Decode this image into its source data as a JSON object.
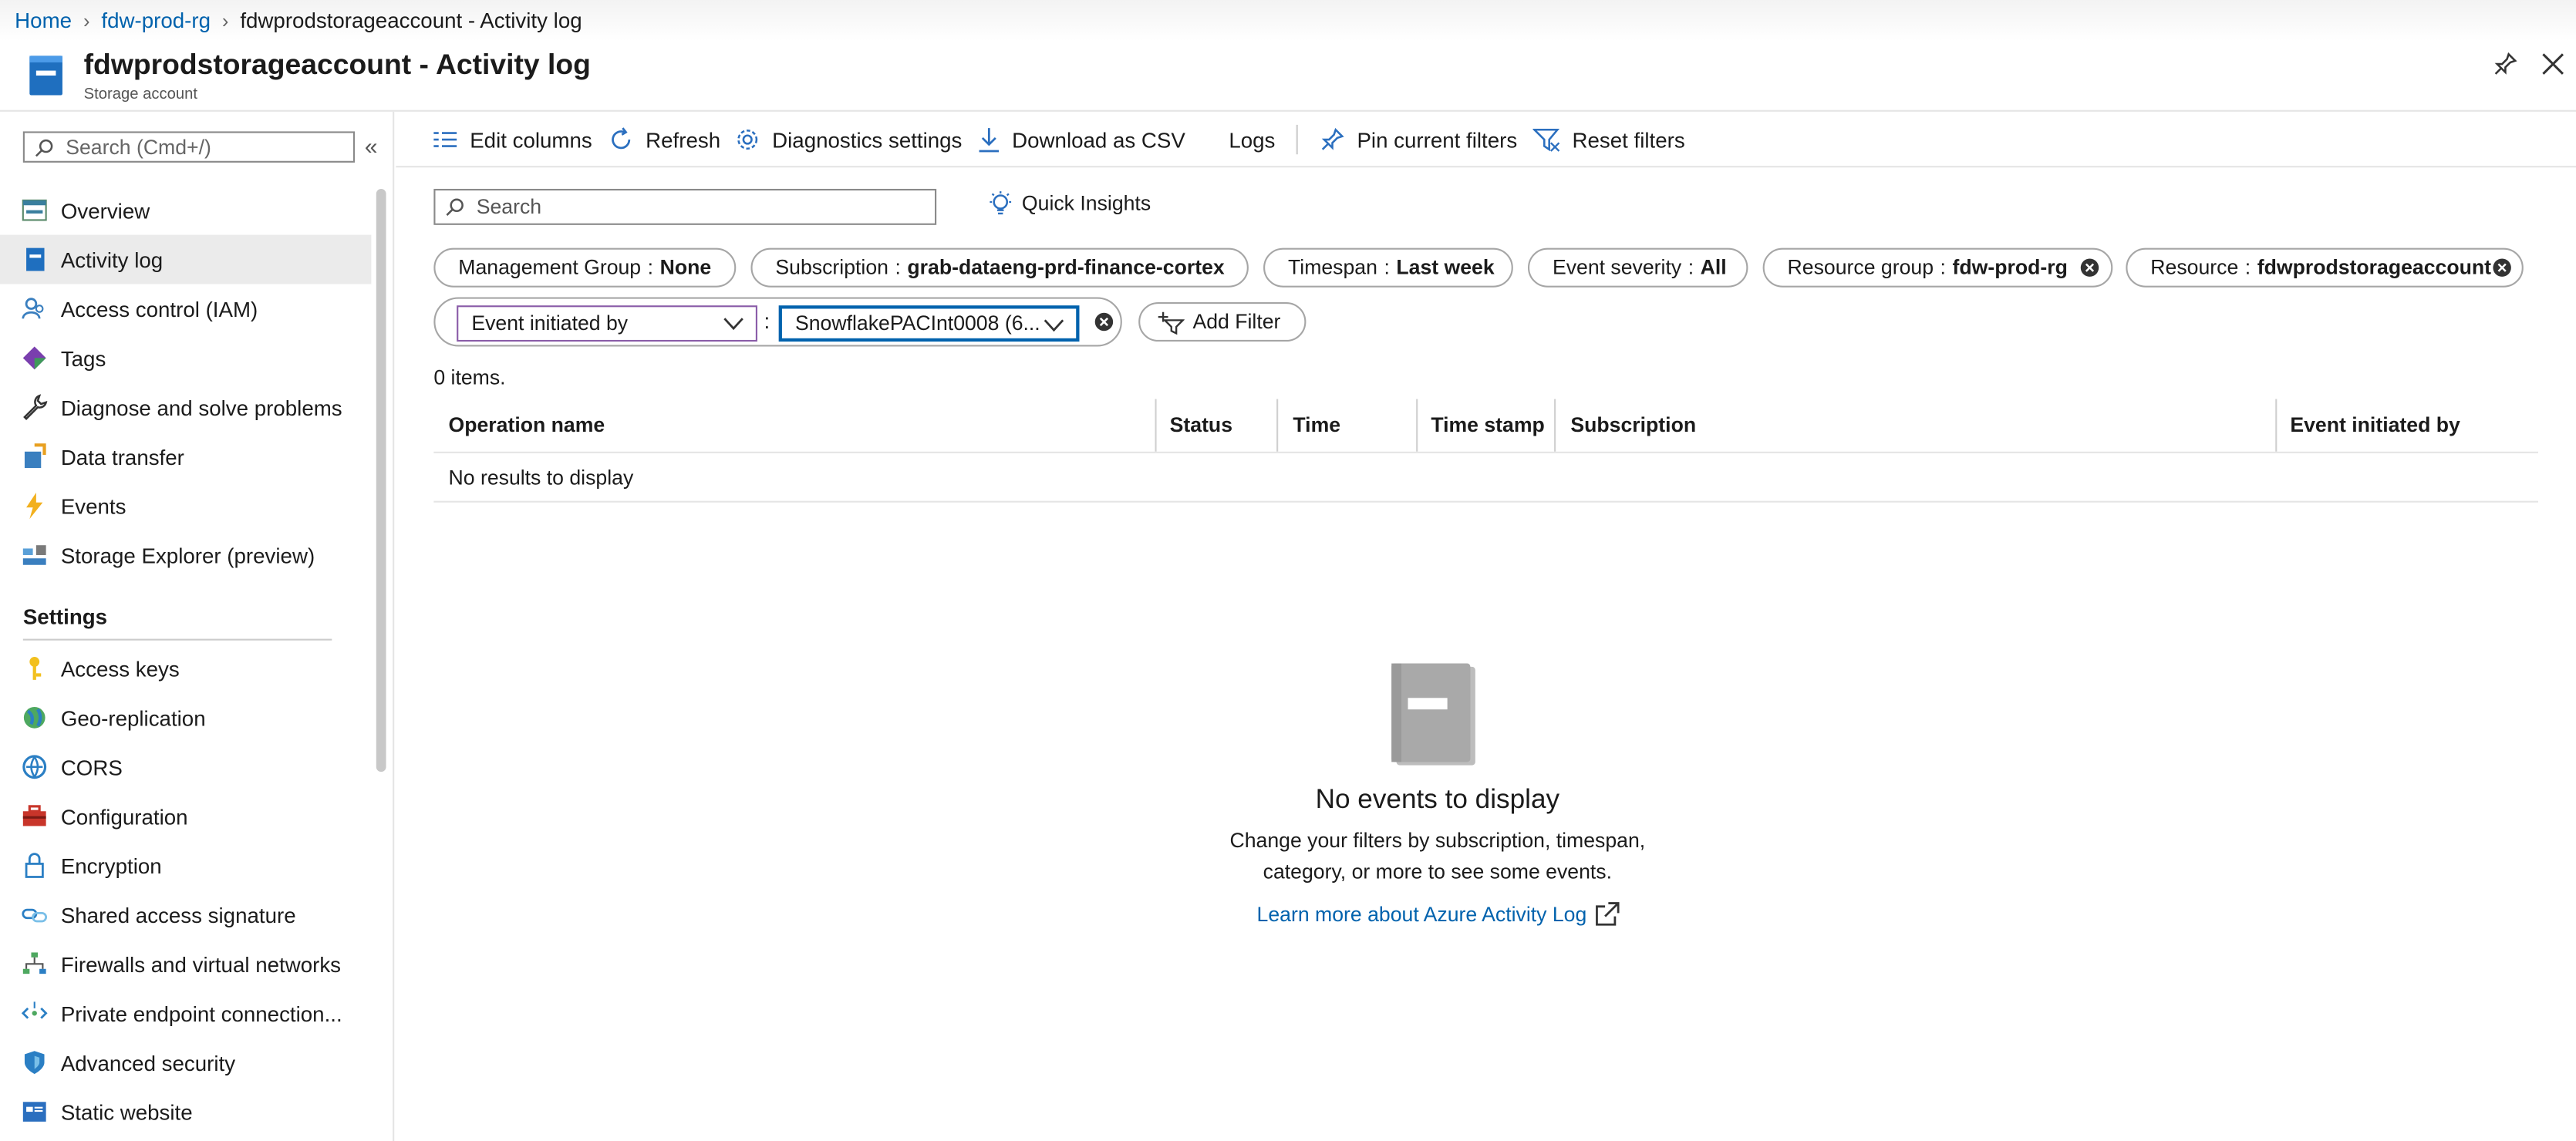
{
  "breadcrumb": {
    "home": "Home",
    "resource_group": "fdw-prod-rg",
    "current": "fdwprodstorageaccount - Activity log"
  },
  "header": {
    "title": "fdwprodstorageaccount - Activity log",
    "subtitle": "Storage account"
  },
  "sidebar": {
    "search_placeholder": "Search (Cmd+/)",
    "collapse_glyph": "«",
    "items": [
      {
        "label": "Overview",
        "icon": "overview-icon"
      },
      {
        "label": "Activity log",
        "icon": "activity-log-icon",
        "active": true
      },
      {
        "label": "Access control (IAM)",
        "icon": "iam-icon"
      },
      {
        "label": "Tags",
        "icon": "tag-icon"
      },
      {
        "label": "Diagnose and solve problems",
        "icon": "wrench-icon"
      },
      {
        "label": "Data transfer",
        "icon": "data-transfer-icon"
      },
      {
        "label": "Events",
        "icon": "lightning-icon"
      },
      {
        "label": "Storage Explorer (preview)",
        "icon": "storage-explorer-icon"
      }
    ],
    "settings_heading": "Settings",
    "settings_items": [
      {
        "label": "Access keys",
        "icon": "key-icon"
      },
      {
        "label": "Geo-replication",
        "icon": "globe-icon"
      },
      {
        "label": "CORS",
        "icon": "cors-icon"
      },
      {
        "label": "Configuration",
        "icon": "toolbox-icon"
      },
      {
        "label": "Encryption",
        "icon": "lock-icon"
      },
      {
        "label": "Shared access signature",
        "icon": "link-icon"
      },
      {
        "label": "Firewalls and virtual networks",
        "icon": "network-icon"
      },
      {
        "label": "Private endpoint connection...",
        "icon": "endpoint-icon"
      },
      {
        "label": "Advanced security",
        "icon": "shield-icon"
      },
      {
        "label": "Static website",
        "icon": "website-icon"
      }
    ]
  },
  "toolbar": {
    "edit_columns": "Edit columns",
    "refresh": "Refresh",
    "diagnostics_settings": "Diagnostics settings",
    "download_csv": "Download as CSV",
    "logs": "Logs",
    "pin_filters": "Pin current filters",
    "reset_filters": "Reset filters"
  },
  "search": {
    "placeholder": "Search",
    "quick_insights": "Quick Insights"
  },
  "filters": [
    {
      "key": "Management Group",
      "value": "None",
      "removable": false
    },
    {
      "key": "Subscription",
      "value": "grab-dataeng-prd-finance-cortex",
      "removable": false
    },
    {
      "key": "Timespan",
      "value": "Last week",
      "removable": false
    },
    {
      "key": "Event severity",
      "value": "All",
      "removable": false
    },
    {
      "key": "Resource group",
      "value": "fdw-prod-rg",
      "removable": true
    },
    {
      "key": "Resource",
      "value": "fdwprodstorageaccount",
      "removable": true
    }
  ],
  "filter_separator": ":",
  "custom_filter": {
    "field": "Event initiated by",
    "value": "SnowflakePACInt0008 (6..."
  },
  "add_filter": "Add Filter",
  "item_count": "0 items.",
  "table": {
    "columns": [
      "Operation name",
      "Status",
      "Time",
      "Time stamp",
      "Subscription",
      "Event initiated by"
    ],
    "empty_row": "No results to display"
  },
  "empty_state": {
    "title": "No events to display",
    "description": "Change your filters by subscription, timespan, category, or more to see some events.",
    "link": "Learn more about Azure Activity Log"
  },
  "colors": {
    "accent": "#0062ad",
    "link": "#0062ad",
    "border": "#a6a6a6"
  }
}
